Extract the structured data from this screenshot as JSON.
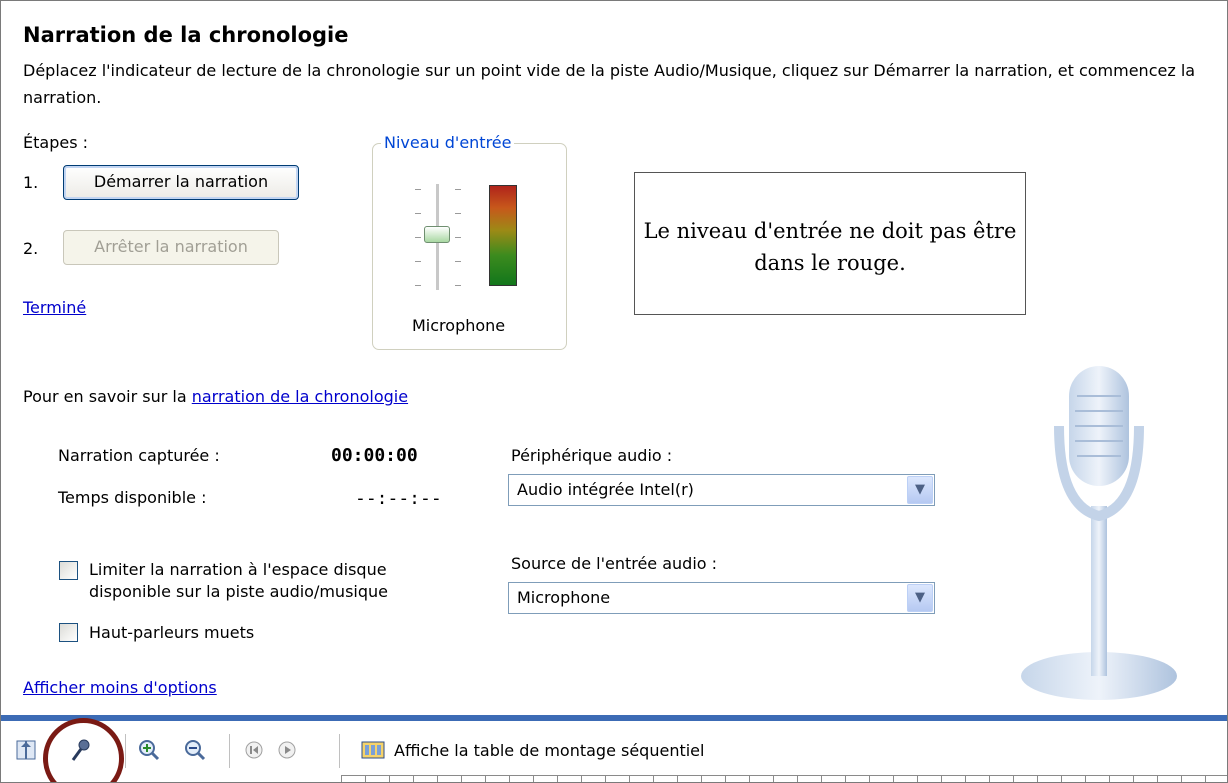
{
  "title": "Narration de la chronologie",
  "description": "Déplacez l'indicateur de lecture de la chronologie sur un point vide de la piste Audio/Musique, cliquez sur Démarrer la narration, et commencez la narration.",
  "steps": {
    "label": "Étapes :",
    "step1_num": "1.",
    "step1_button": "Démarrer la narration",
    "step2_num": "2.",
    "step2_button": "Arrêter la narration",
    "done_link": "Terminé"
  },
  "input_level": {
    "legend": "Niveau d'entrée",
    "device_label": "Microphone",
    "slider_level": 0.5
  },
  "note": "Le niveau d'entrée ne doit pas être dans le rouge.",
  "learn_more": {
    "prefix": "Pour en savoir sur la ",
    "link": "narration de la chronologie"
  },
  "capture": {
    "captured_label": "Narration capturée :",
    "captured_value": "00:00:00",
    "available_label": "Temps disponible :",
    "available_value": "--:--:--"
  },
  "audio_device": {
    "label": "Périphérique audio :",
    "value": "Audio intégrée Intel(r)"
  },
  "audio_source": {
    "label": "Source de l'entrée audio :",
    "value": "Microphone"
  },
  "options": {
    "limit_line1": "Limiter la narration à l'espace disque",
    "limit_line2": "disponible sur la piste audio/musique",
    "mute": "Haut-parleurs muets",
    "fewer_options": "Afficher moins d'options"
  },
  "toolbar": {
    "storyboard": "Affiche la table de montage séquentiel",
    "icons": [
      "timeline-icon",
      "narrate-microphone-icon",
      "zoom-in-icon",
      "zoom-out-icon",
      "rewind-icon",
      "play-icon",
      "storyboard-icon"
    ]
  },
  "colors": {
    "link": "#0000cc",
    "accent_blue": "#3c6bb5",
    "highlight_ring": "#7a1a14",
    "legend_blue": "#0046d5"
  }
}
